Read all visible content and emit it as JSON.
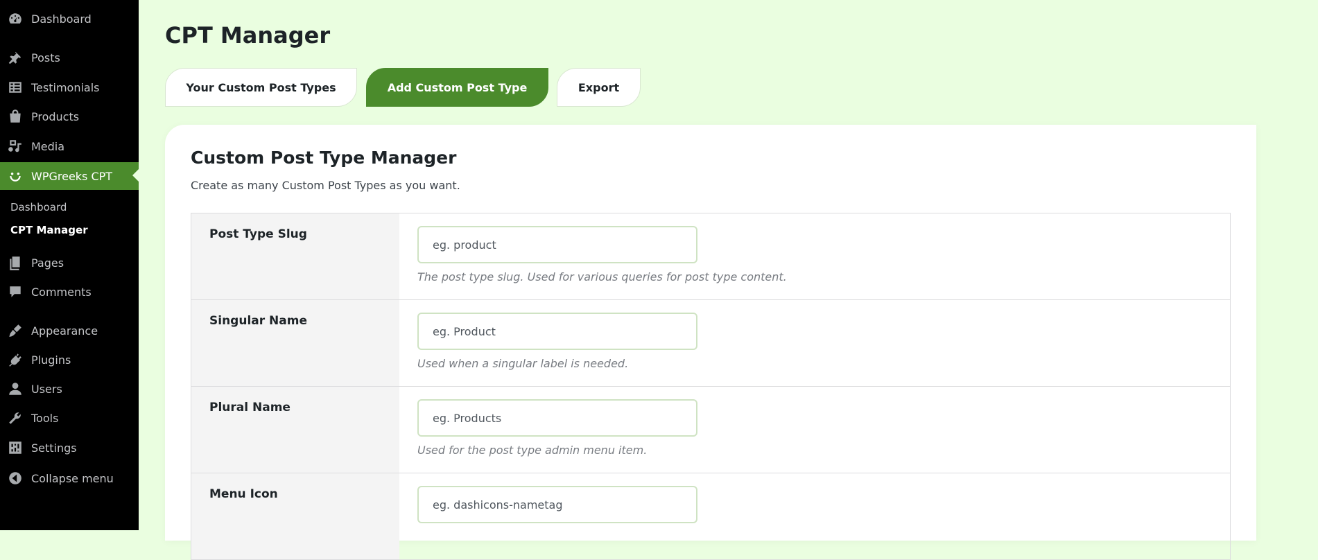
{
  "sidebar": {
    "items": [
      {
        "label": "Dashboard",
        "icon": "dashboard-icon"
      },
      {
        "label": "Posts",
        "icon": "pin-icon"
      },
      {
        "label": "Testimonials",
        "icon": "list-icon"
      },
      {
        "label": "Products",
        "icon": "bag-icon"
      },
      {
        "label": "Media",
        "icon": "media-icon"
      },
      {
        "label": "WPGreeks CPT",
        "icon": "smiley-icon"
      },
      {
        "label": "Pages",
        "icon": "pages-icon"
      },
      {
        "label": "Comments",
        "icon": "comment-icon"
      },
      {
        "label": "Appearance",
        "icon": "brush-icon"
      },
      {
        "label": "Plugins",
        "icon": "plug-icon"
      },
      {
        "label": "Users",
        "icon": "user-icon"
      },
      {
        "label": "Tools",
        "icon": "wrench-icon"
      },
      {
        "label": "Settings",
        "icon": "settings-icon"
      },
      {
        "label": "Collapse menu",
        "icon": "collapse-icon"
      }
    ],
    "submenu": [
      {
        "label": "Dashboard"
      },
      {
        "label": "CPT Manager"
      }
    ]
  },
  "header": {
    "title": "CPT Manager"
  },
  "tabs": [
    {
      "label": "Your Custom Post Types"
    },
    {
      "label": "Add Custom Post Type"
    },
    {
      "label": "Export"
    }
  ],
  "card": {
    "title": "Custom Post Type Manager",
    "description": "Create as many Custom Post Types as you want."
  },
  "form": [
    {
      "label": "Post Type Slug",
      "placeholder": "eg. product",
      "help": "The post type slug. Used for various queries for post type content."
    },
    {
      "label": "Singular Name",
      "placeholder": "eg. Product",
      "help": "Used when a singular label is needed."
    },
    {
      "label": "Plural Name",
      "placeholder": "eg. Products",
      "help": "Used for the post type admin menu item."
    },
    {
      "label": "Menu Icon",
      "placeholder": "eg. dashicons-nametag",
      "help": ""
    }
  ],
  "colors": {
    "accent": "#4b8b2c",
    "page_bg": "#eafee0",
    "sidebar_bg": "#000000"
  }
}
